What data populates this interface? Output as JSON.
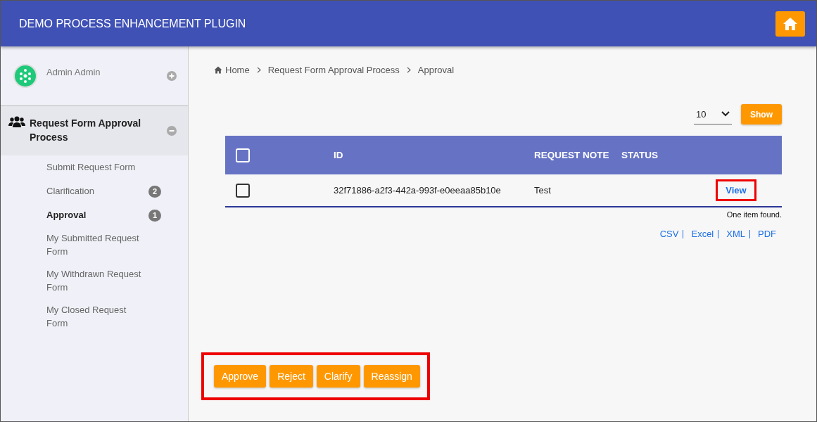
{
  "header": {
    "title": "DEMO PROCESS ENHANCEMENT PLUGIN"
  },
  "sidebar": {
    "user": "Admin Admin",
    "group": {
      "title": "Request Form Approval Process",
      "expanded": true
    },
    "items": [
      {
        "label": "Submit Request Form",
        "selected": false
      },
      {
        "label": "Clarification",
        "selected": false,
        "badge": "2"
      },
      {
        "label": "Approval",
        "selected": true,
        "badge": "1"
      },
      {
        "label": "My Submitted Request Form",
        "selected": false
      },
      {
        "label": "My Withdrawn Request Form",
        "selected": false
      },
      {
        "label": "My Closed Request Form",
        "selected": false
      }
    ]
  },
  "breadcrumb": [
    "Home",
    "Request Form Approval Process",
    "Approval"
  ],
  "page_size": {
    "value": "10",
    "button": "Show"
  },
  "table": {
    "select_all_checked": false,
    "columns": [
      "ID",
      "REQUEST NOTE",
      "STATUS"
    ],
    "rows": [
      {
        "checked": false,
        "id": "32f71886-a2f3-442a-993f-e0eeaa85b10e",
        "note": "Test",
        "action": "View",
        "highlighted": true
      }
    ],
    "footer": "One item found."
  },
  "exports": [
    "CSV",
    "Excel",
    "XML",
    "PDF"
  ],
  "actions": {
    "highlighted": true,
    "buttons": [
      "Approve",
      "Reject",
      "Clarify",
      "Reassign"
    ]
  }
}
